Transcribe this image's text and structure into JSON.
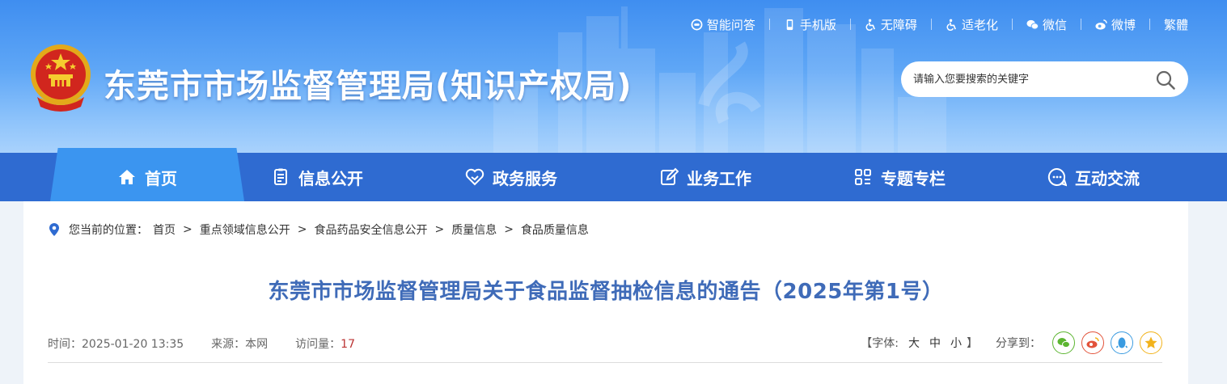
{
  "header": {
    "site_title": "东莞市市场监督管理局(知识产权局)",
    "top_links": [
      {
        "label": "智能问答",
        "icon": "chat-bot-icon"
      },
      {
        "label": "手机版",
        "icon": "mobile-icon"
      },
      {
        "label": "无障碍",
        "icon": "accessibility-icon"
      },
      {
        "label": "适老化",
        "icon": "elder-care-icon"
      },
      {
        "label": "微信",
        "icon": "wechat-icon"
      },
      {
        "label": "微博",
        "icon": "weibo-icon"
      },
      {
        "label": "繁體",
        "icon": ""
      }
    ],
    "search": {
      "placeholder": "请输入您要搜索的关键字"
    }
  },
  "nav": {
    "items": [
      {
        "label": "首页",
        "icon": "home-icon",
        "active": true
      },
      {
        "label": "信息公开",
        "icon": "document-icon"
      },
      {
        "label": "政务服务",
        "icon": "heart-hands-icon"
      },
      {
        "label": "业务工作",
        "icon": "edit-icon"
      },
      {
        "label": "专题专栏",
        "icon": "grid-icon"
      },
      {
        "label": "互动交流",
        "icon": "chat-icon"
      }
    ]
  },
  "breadcrumb": {
    "here_label": "您当前的位置：",
    "items": [
      "首页",
      "重点领域信息公开",
      "食品药品安全信息公开",
      "质量信息",
      "食品质量信息"
    ],
    "separator": ">"
  },
  "article": {
    "title": "东莞市市场监督管理局关于食品监督抽检信息的通告（2025年第1号）",
    "time_label": "时间：",
    "time": "2025-01-20 13:35",
    "source_label": "来源：",
    "source": "本网",
    "views_label": "访问量：",
    "views": "17"
  },
  "tools": {
    "font_open": "【字体:",
    "font_large": "大",
    "font_medium": "中",
    "font_small": "小",
    "font_close": "】",
    "share_label": "分享到："
  },
  "colors": {
    "nav_bg": "#2f6bd1",
    "nav_active": "#3b95f0",
    "title_blue": "#3f6bb8",
    "wechat": "#5cb531",
    "weibo": "#e2533a",
    "qq": "#3a9be0",
    "qzone": "#f2b31c"
  }
}
